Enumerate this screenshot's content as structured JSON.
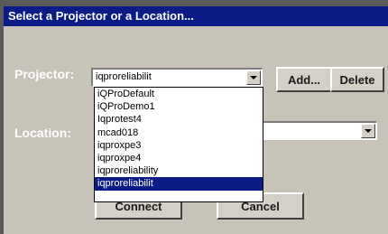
{
  "window": {
    "title": "Select a Projector or a Location..."
  },
  "projector": {
    "label": "Projector:",
    "value": "iqproreliabilit",
    "options": [
      "iQProDefault",
      "iQProDemo1",
      "Iqprotest4",
      "mcad018",
      "iqproxpe3",
      "iqproxpe4",
      "iqproreliability",
      "iqproreliabilit"
    ],
    "selected_index": 7
  },
  "location": {
    "label": "Location:",
    "value": ""
  },
  "buttons": {
    "add": "Add...",
    "delete": "Delete",
    "connect": "Connect",
    "cancel": "Cancel"
  },
  "colors": {
    "title_bar": "#0b1c86",
    "window_bg": "#c7c3b9",
    "selection": "#0b1c86"
  }
}
